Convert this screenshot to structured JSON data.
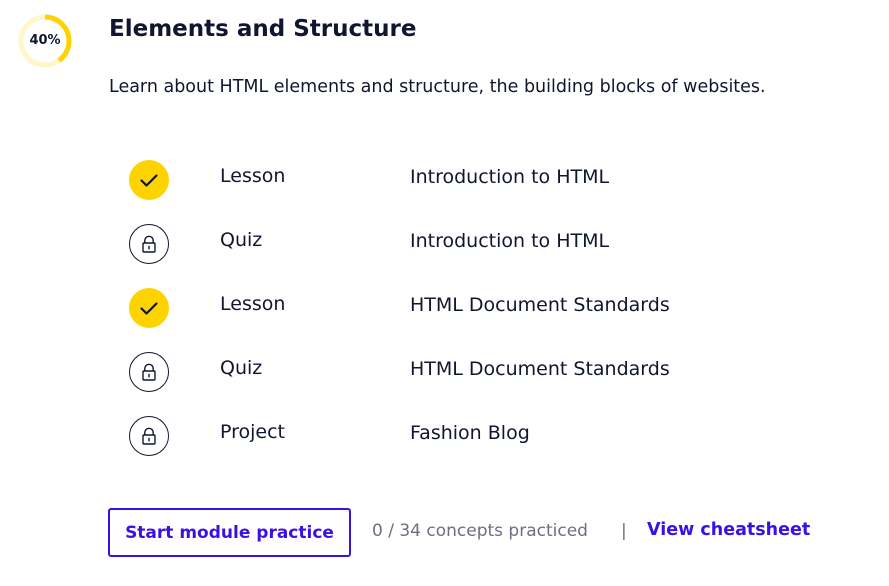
{
  "module": {
    "progress": {
      "label": "40%",
      "fraction": 0.4,
      "track_color": "#fff6c9",
      "fill_color": "#ffd300"
    },
    "title": "Elements and Structure",
    "description": "Learn about HTML elements and structure, the building blocks of websites."
  },
  "items": [
    {
      "status": "completed",
      "icon": "check-icon",
      "type": "Lesson",
      "name": "Introduction to HTML"
    },
    {
      "status": "locked",
      "icon": "lock-icon",
      "type": "Quiz",
      "name": "Introduction to HTML"
    },
    {
      "status": "completed",
      "icon": "check-icon",
      "type": "Lesson",
      "name": "HTML Document Standards"
    },
    {
      "status": "locked",
      "icon": "lock-icon",
      "type": "Quiz",
      "name": "HTML Document Standards"
    },
    {
      "status": "locked",
      "icon": "lock-icon",
      "type": "Project",
      "name": "Fashion Blog"
    }
  ],
  "footer": {
    "practice_button_label": "Start module practice",
    "concepts_text": "0 / 34 concepts practiced",
    "separator": "|",
    "cheatsheet_label": "View cheatsheet"
  },
  "colors": {
    "accent": "#3a10e5",
    "completed": "#ffd300",
    "text": "#10162f",
    "muted": "#6b6f80"
  }
}
